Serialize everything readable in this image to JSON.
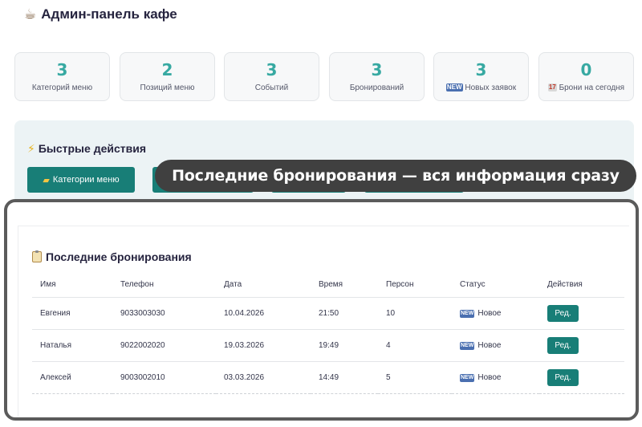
{
  "header": {
    "title": "Админ-панель кафе",
    "icon": "coffee-cup-icon"
  },
  "stats": [
    {
      "value": "3",
      "label": "Категорий меню",
      "icon": ""
    },
    {
      "value": "2",
      "label": "Позиций меню",
      "icon": ""
    },
    {
      "value": "3",
      "label": "Событий",
      "icon": ""
    },
    {
      "value": "3",
      "label": "Бронирований",
      "icon": ""
    },
    {
      "value": "3",
      "label": "Новых заявок",
      "icon": "new-badge-icon"
    },
    {
      "value": "0",
      "label": "Брони на сегодня",
      "icon": "calendar-icon"
    }
  ],
  "quick_actions": {
    "title": "Быстрые действия",
    "title_icon": "lightning-icon",
    "buttons": [
      {
        "label": "Категории меню",
        "icon": "folder-icon"
      },
      {
        "label": "",
        "icon": ""
      },
      {
        "label": "",
        "icon": ""
      },
      {
        "label": "",
        "icon": ""
      }
    ]
  },
  "banner": {
    "text": "Последние бронирования — вся информация сразу"
  },
  "bookings": {
    "title": "Последние бронирования",
    "title_icon": "clipboard-icon",
    "columns": [
      "Имя",
      "Телефон",
      "Дата",
      "Время",
      "Персон",
      "Статус",
      "Действия"
    ],
    "rows": [
      {
        "name": "Евгения",
        "phone": "9033003030",
        "date": "10.04.2026",
        "time": "21:50",
        "guests": "10",
        "status": "Новое",
        "action": "Ред."
      },
      {
        "name": "Наталья",
        "phone": "9022002020",
        "date": "19.03.2026",
        "time": "19:49",
        "guests": "4",
        "status": "Новое",
        "action": "Ред."
      },
      {
        "name": "Алексей",
        "phone": "9003002010",
        "date": "03.03.2026",
        "time": "14:49",
        "guests": "5",
        "status": "Новое",
        "action": "Ред."
      }
    ]
  },
  "colors": {
    "accent": "#37a9a2",
    "button": "#187e77",
    "banner": "#404040",
    "status_icon": "#4a6fb0"
  }
}
